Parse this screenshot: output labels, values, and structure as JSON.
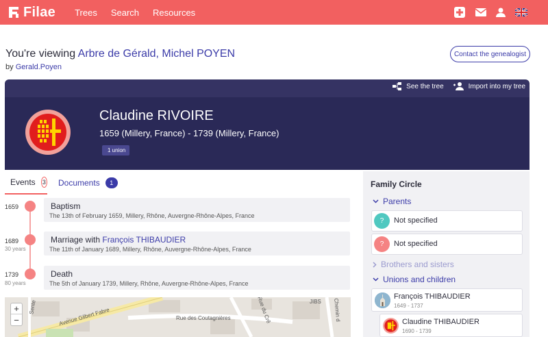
{
  "nav": {
    "logo": "Filae",
    "links": [
      "Trees",
      "Search",
      "Resources"
    ],
    "icons": [
      "add-person-icon",
      "mail-icon",
      "user-icon",
      "uk-flag-icon"
    ]
  },
  "header": {
    "viewing_prefix": "You're viewing",
    "tree_name": "Arbre de Gérald, Michel POYEN",
    "by_prefix": "by",
    "author": "Gerald.Poyen",
    "contact_label": "Contact the genealogist"
  },
  "card": {
    "action_share": "See the tree",
    "action_import": "Import into my tree",
    "name": "Claudine RIVOIRE",
    "dates": "1659 (Millery, France) - 1739 (Millery, France)",
    "union_badge": "1 union"
  },
  "tabs": [
    {
      "label": "Events",
      "count": "3"
    },
    {
      "label": "Documents",
      "count": "1"
    }
  ],
  "events": [
    {
      "year": "1659",
      "age": "",
      "title": "Baptism",
      "link": "",
      "detail": "The 13th of February 1659, Millery, Rhône, Auvergne-Rhône-Alpes, France"
    },
    {
      "year": "1689",
      "age": "30 years",
      "title": "Marriage with",
      "link": "François THIBAUDIER",
      "detail": "The 11th of January 1689, Millery, Rhône, Auvergne-Rhône-Alpes, France"
    },
    {
      "year": "1739",
      "age": "80 years",
      "title": "Death",
      "link": "",
      "detail": "The 5th of January 1739, Millery, Rhône, Auvergne-Rhône-Alpes, France"
    }
  ],
  "map": {
    "zoom_in": "+",
    "zoom_out": "−",
    "labels": [
      "Avenue Gilbert Fabre",
      "Rue des Coutagnières",
      "Rue du Crê",
      "Chemin d",
      "Sente",
      "JIBS"
    ]
  },
  "family": {
    "title": "Family Circle",
    "parents_label": "Parents",
    "parents": [
      {
        "label": "Not specified",
        "color": "#4fc8c0",
        "mark": "?"
      },
      {
        "label": "Not specified",
        "color": "#f58383",
        "mark": "?"
      }
    ],
    "siblings_label": "Brothers and sisters",
    "unions_label": "Unions and children",
    "spouse": {
      "name": "François THIBAUDIER",
      "years": "1649 - 1737"
    },
    "child": {
      "name": "Claudine THIBAUDIER",
      "years": "1690 - 1739"
    }
  },
  "colors": {
    "brand": "#f26060",
    "navy": "#2a2957",
    "link": "#3b3ba8"
  }
}
